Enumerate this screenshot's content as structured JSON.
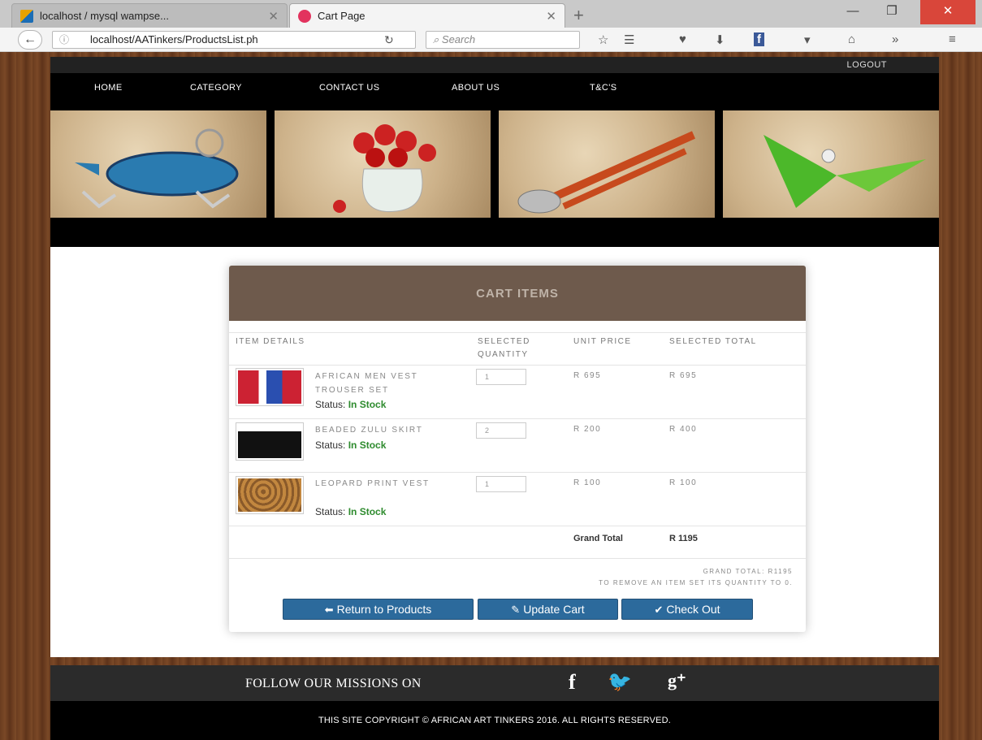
{
  "browser": {
    "tabs": [
      {
        "title": "localhost / mysql wampse...",
        "active": false
      },
      {
        "title": "Cart Page",
        "active": true
      }
    ],
    "url": "localhost/AATinkers/ProductsList.ph",
    "search_placeholder": "Search"
  },
  "site": {
    "logout": "LOGOUT",
    "nav": [
      "HOME",
      "CATEGORY",
      "CONTACT US",
      "ABOUT US",
      "T&C'S"
    ]
  },
  "cart": {
    "title": "CART ITEMS",
    "headers": {
      "details": "ITEM DETAILS",
      "qty": "SELECTED QUANTITY",
      "unit": "UNIT PRICE",
      "total": "SELECTED TOTAL"
    },
    "items": [
      {
        "name": "AFRICAN MEN VEST TROUSER SET",
        "status_label": "Status:",
        "status": "In Stock",
        "qty": "1",
        "unit_price": "R 695",
        "total": "R 695"
      },
      {
        "name": "BEADED ZULU SKIRT",
        "status_label": "Status:",
        "status": "In Stock",
        "qty": "2",
        "unit_price": "R 200",
        "total": "R 400"
      },
      {
        "name": "LEOPARD PRINT VEST",
        "status_label": "Status:",
        "status": "In Stock",
        "qty": "1",
        "unit_price": "R 100",
        "total": "R 100"
      }
    ],
    "grand_total_label": "Grand Total",
    "grand_total_value": "R 1195",
    "summary": "GRAND TOTAL: R1195",
    "remove_note": "TO REMOVE AN ITEM SET ITS QUANTITY TO 0.",
    "buttons": {
      "return": "Return to Products",
      "update": "Update Cart",
      "checkout": "Check Out"
    }
  },
  "footer": {
    "follow": "FOLLOW OUR MISSIONS ON",
    "social": [
      "f",
      "twitter",
      "g+"
    ],
    "copyright": "THIS SITE COPYRIGHT © AFRICAN ART TINKERS 2016. ALL RIGHTS RESERVED."
  },
  "colors": {
    "cart_header_bg": "#6e5a4c",
    "button_bg": "#2c6a9c",
    "in_stock": "#2e8b2e"
  }
}
